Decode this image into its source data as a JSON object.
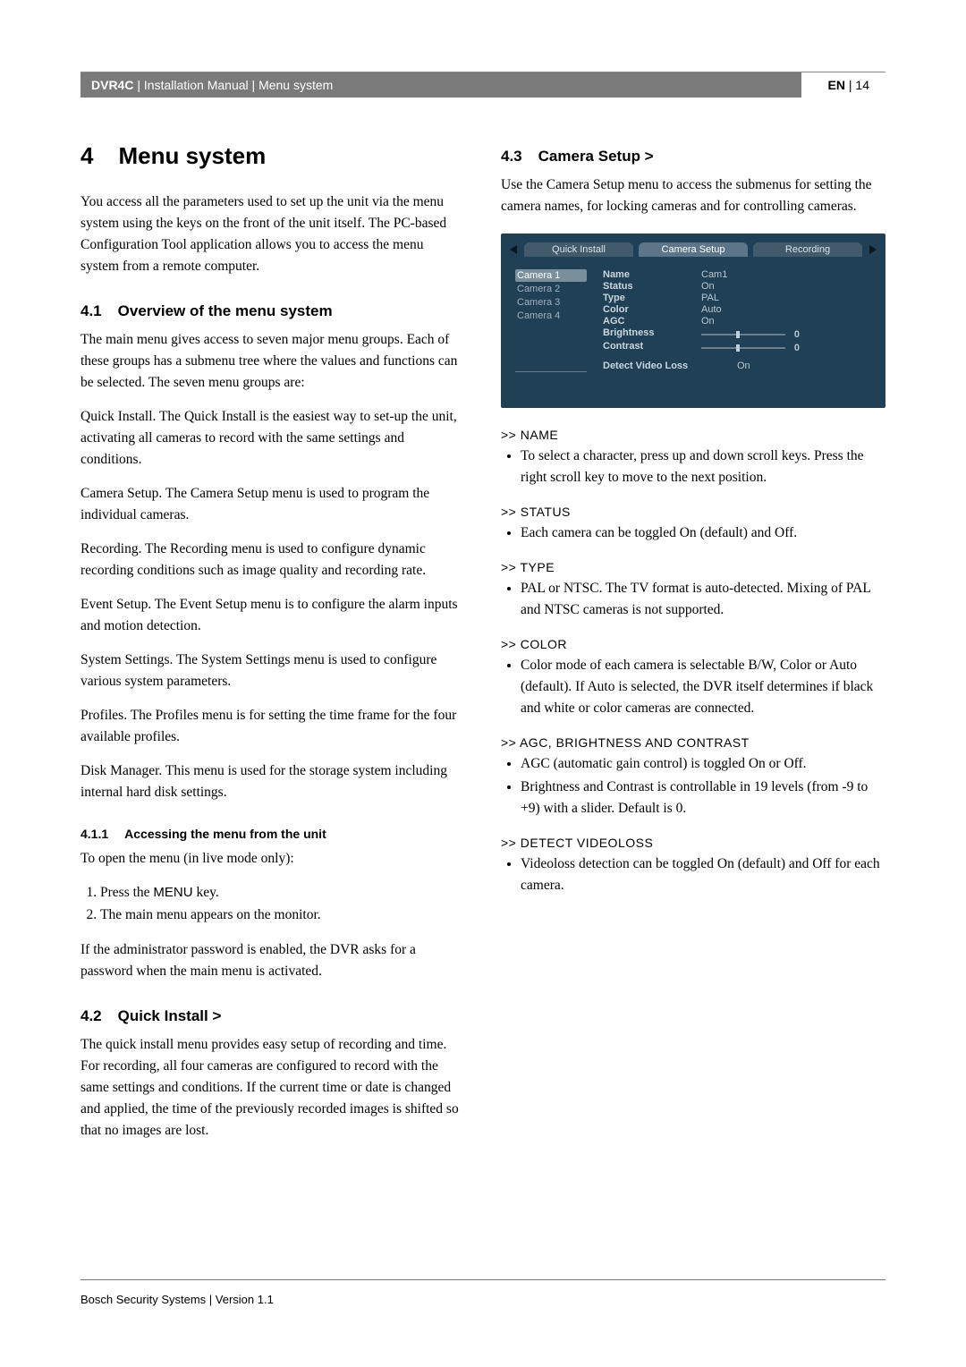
{
  "header": {
    "product": "DVR4C",
    "separator": " | ",
    "doc": "Installation Manual",
    "crumb": "Menu system",
    "lang": "EN",
    "page": "14"
  },
  "chapter": {
    "num": "4",
    "title": "Menu system"
  },
  "intro": "You access all the parameters used to set up the unit via the menu system using the keys on the front of the unit itself. The PC-based Configuration Tool application allows you to access the menu system from a remote computer.",
  "s41": {
    "num": "4.1",
    "title": "Overview of the menu system",
    "p1": "The main menu gives access to seven major menu groups. Each of these groups has a submenu tree where the values and functions can be selected. The seven menu groups are:",
    "p2": "Quick Install. The Quick Install is the easiest way to set-up the unit, activating all cameras to record with the same settings and conditions.",
    "p3": "Camera Setup. The Camera Setup menu is used to program the individual cameras.",
    "p4": "Recording. The Recording menu is used to configure dynamic recording conditions such as image quality and recording rate.",
    "p5": "Event Setup. The Event Setup menu is to configure the alarm inputs and motion detection.",
    "p6": "System Settings. The System Settings menu is used to configure various system parameters.",
    "p7": "Profiles. The Profiles menu is for setting the time frame for the four available profiles.",
    "p8": "Disk Manager. This menu is used for the storage system including internal hard disk settings."
  },
  "s411": {
    "num": "4.1.1",
    "title": "Accessing the menu from the unit",
    "lead": "To open the menu (in live mode only):",
    "step1a": "Press the ",
    "menuKey": "MENU",
    "step1b": " key.",
    "step2": "The main menu appears on the monitor.",
    "note": "If the administrator password is enabled, the DVR asks for a password when the main menu is activated."
  },
  "s42": {
    "num": "4.2",
    "title": "Quick Install >",
    "body": "The quick install menu provides easy setup of recording and time. For recording, all four cameras are configured to record with the same settings and conditions. If the current time or date is changed and applied, the time of the previously recorded images is shifted so that no images are lost."
  },
  "s43": {
    "num": "4.3",
    "title": "Camera Setup >",
    "lead": "Use the Camera Setup menu to access the submenus for setting the camera names, for locking cameras and for controlling cameras."
  },
  "shot": {
    "tabs": [
      "Quick Install",
      "Camera Setup",
      "Recording"
    ],
    "cams": [
      "Camera 1",
      "Camera 2",
      "Camera 3",
      "Camera 4"
    ],
    "props": {
      "name": {
        "label": "Name",
        "value": "Cam1"
      },
      "status": {
        "label": "Status",
        "value": "On"
      },
      "type": {
        "label": "Type",
        "value": "PAL"
      },
      "color": {
        "label": "Color",
        "value": "Auto"
      },
      "agc": {
        "label": "AGC",
        "value": "On"
      },
      "brightness": {
        "label": "Brightness",
        "value": "0"
      },
      "contrast": {
        "label": "Contrast",
        "value": "0"
      },
      "dvl": {
        "label": "Detect Video Loss",
        "value": "On"
      }
    }
  },
  "params": {
    "name": {
      "h": ">> NAME",
      "b1": "To select a character, press up and down scroll keys. Press the right scroll key to move to the next position."
    },
    "status": {
      "h": ">> STATUS",
      "b1": "Each camera can be toggled On (default) and Off."
    },
    "type": {
      "h": ">> TYPE",
      "b1": "PAL or NTSC. The TV format is auto-detected. Mixing of PAL and NTSC cameras is not supported."
    },
    "color": {
      "h": ">> COLOR",
      "b1": "Color mode of each camera is selectable B/W, Color or Auto (default). If Auto is selected, the DVR itself determines if black and white or color cameras are connected."
    },
    "agc": {
      "h": ">> AGC, BRIGHTNESS AND CONTRAST",
      "b1": "AGC (automatic gain control) is toggled On or Off.",
      "b2": "Brightness and Contrast is controllable in 19 levels (from -9 to +9) with a slider. Default is 0."
    },
    "dvl": {
      "h": ">> DETECT VIDEOLOSS",
      "b1": "Videoloss detection can be toggled On (default) and Off for each camera."
    }
  },
  "footer": "Bosch Security Systems | Version 1.1"
}
